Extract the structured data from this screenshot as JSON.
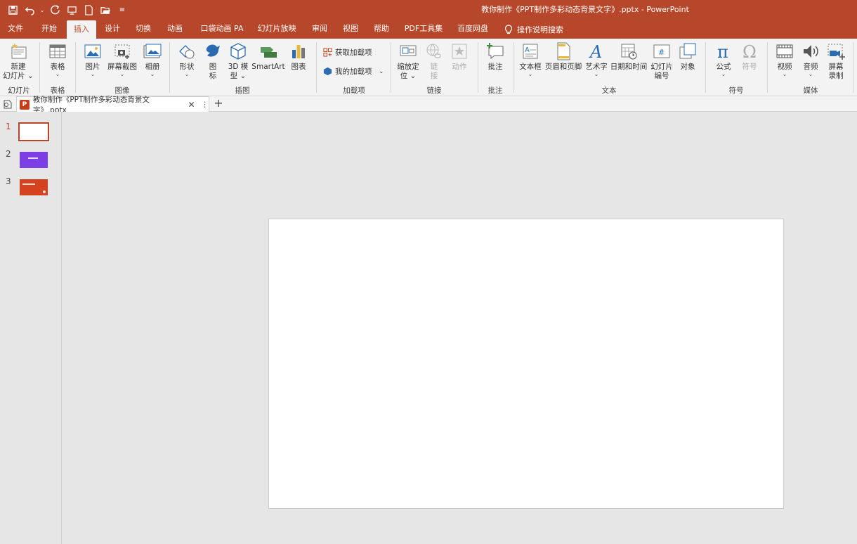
{
  "window": {
    "title": "教你制作《PPT制作多彩动态背景文字》.pptx  -  PowerPoint"
  },
  "quick_access": [
    "save-icon",
    "undo-icon",
    "redo-icon",
    "present-icon",
    "new-icon",
    "open-icon",
    "customize-icon"
  ],
  "tabs": [
    {
      "label": "文件"
    },
    {
      "label": "开始"
    },
    {
      "label": "插入",
      "active": true
    },
    {
      "label": "设计"
    },
    {
      "label": "切换"
    },
    {
      "label": "动画"
    },
    {
      "label": "口袋动画 PA"
    },
    {
      "label": "幻灯片放映"
    },
    {
      "label": "审阅"
    },
    {
      "label": "视图"
    },
    {
      "label": "帮助"
    },
    {
      "label": "PDF工具集"
    },
    {
      "label": "百度网盘"
    }
  ],
  "tell_me": "操作说明搜索",
  "ribbon": {
    "new_slide": {
      "line1": "新建",
      "line2": "幻灯片"
    },
    "table": "表格",
    "picture": "图片",
    "screenshot": "屏幕截图",
    "album": "相册",
    "shapes": "形状",
    "icons": {
      "line1": "图",
      "line2": "标"
    },
    "model3d": {
      "line1": "3D 模",
      "line2": "型"
    },
    "smartart": "SmartArt",
    "chart": "图表",
    "get_addins": "获取加载项",
    "my_addins": "我的加载项",
    "zoom": {
      "line1": "缩放定",
      "line2": "位"
    },
    "link": {
      "line1": "链",
      "line2": "接"
    },
    "action": "动作",
    "comment": "批注",
    "textbox": "文本框",
    "header_footer": "页眉和页脚",
    "wordart": "艺术字",
    "datetime": "日期和时间",
    "slide_number": {
      "line1": "幻灯片",
      "line2": "编号"
    },
    "object": "对象",
    "equation": "公式",
    "symbol": "符号",
    "video": "视频",
    "audio": "音频",
    "screen_record": {
      "line1": "屏幕",
      "line2": "录制"
    },
    "groups": {
      "slides": "幻灯片",
      "tables": "表格",
      "images": "图像",
      "illustrations": "插图",
      "addins": "加载项",
      "links": "链接",
      "comments": "批注",
      "text": "文本",
      "symbols": "符号",
      "media": "媒体"
    }
  },
  "doc_tab": {
    "label": "教你制作《PPT制作多彩动态背景文字》.pptx",
    "icon_letter": "P"
  },
  "slides": [
    {
      "number": "1",
      "style": "blank"
    },
    {
      "number": "2",
      "style": "purple"
    },
    {
      "number": "3",
      "style": "red"
    }
  ],
  "colors": {
    "accent": "#b7472a",
    "slide2": "#7b3fe4",
    "slide3": "#d5421f"
  }
}
